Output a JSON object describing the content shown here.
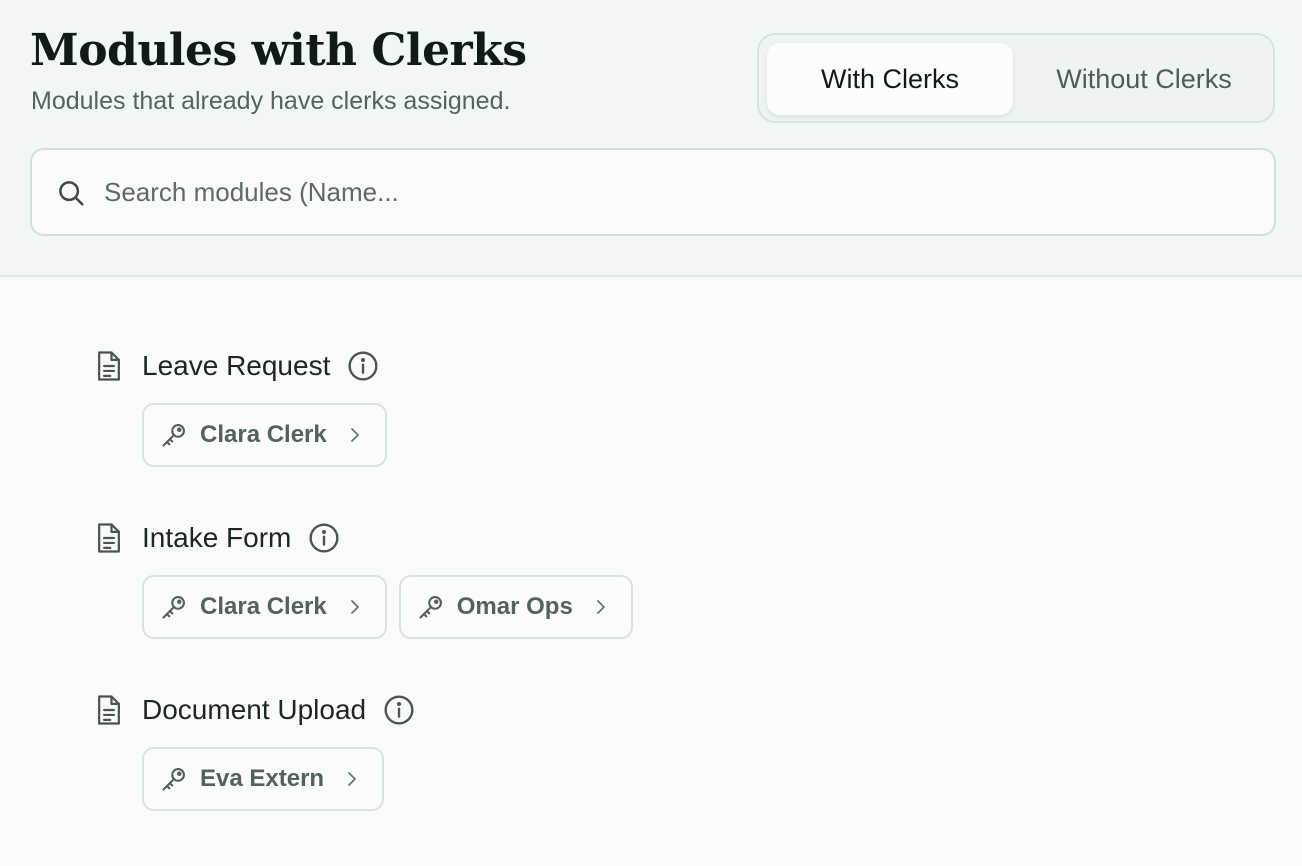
{
  "header": {
    "title": "Modules with Clerks",
    "subtitle": "Modules that already have clerks assigned."
  },
  "toggle": {
    "options": [
      {
        "label": "With Clerks",
        "active": true
      },
      {
        "label": "Without Clerks",
        "active": false
      }
    ]
  },
  "search": {
    "placeholder": "Search modules (Name...",
    "value": ""
  },
  "modules": [
    {
      "name": "Leave Request",
      "clerks": [
        "Clara Clerk"
      ]
    },
    {
      "name": "Intake Form",
      "clerks": [
        "Clara Clerk",
        "Omar Ops"
      ]
    },
    {
      "name": "Document Upload",
      "clerks": [
        "Eva Extern"
      ]
    }
  ],
  "icons": {
    "search": "search-icon",
    "module": "document-icon",
    "info": "info-icon",
    "clerk": "key-icon",
    "open": "chevron-right-icon"
  },
  "colors": {
    "header_bg": "#f1f7f7",
    "page_bg": "#f8fbfa",
    "border": "#d7e3e0",
    "text_primary": "#121a18",
    "text_muted": "#56625f"
  }
}
